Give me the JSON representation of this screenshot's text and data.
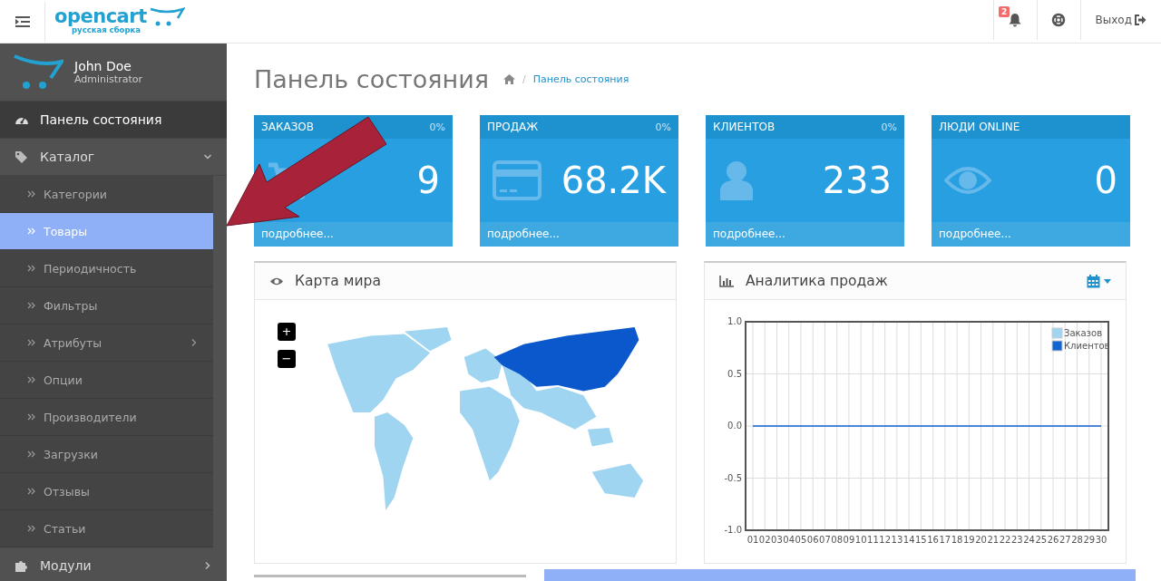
{
  "header": {
    "logo": {
      "name": "opencart",
      "subtitle": "русская сборка"
    },
    "notifications": {
      "count": "2"
    },
    "logout": "Выход"
  },
  "profile": {
    "name": "John Doe",
    "role": "Administrator"
  },
  "sidebar": {
    "items": [
      {
        "label": "Панель состояния",
        "kind": "dashboard",
        "selected": false
      },
      {
        "label": "Каталог",
        "kind": "catalog",
        "selected": false,
        "expanded": true,
        "children": [
          {
            "label": "Категории",
            "selected": false
          },
          {
            "label": "Товары",
            "selected": true
          },
          {
            "label": "Периодичность",
            "selected": false
          },
          {
            "label": "Фильтры",
            "selected": false
          },
          {
            "label": "Атрибуты",
            "selected": false,
            "expanded": false
          },
          {
            "label": "Опции",
            "selected": false
          },
          {
            "label": "Производители",
            "selected": false
          },
          {
            "label": "Загрузки",
            "selected": false
          },
          {
            "label": "Отзывы",
            "selected": false
          },
          {
            "label": "Статьи",
            "selected": false
          }
        ]
      },
      {
        "label": "Модули",
        "kind": "modules",
        "selected": false,
        "expanded": false
      }
    ]
  },
  "page": {
    "title": "Панель состояния",
    "breadcrumb": [
      {
        "separator": "/",
        "label": "Панель состояния"
      }
    ]
  },
  "stats": [
    {
      "kind": "orders",
      "title": "ЗАКАЗОВ",
      "percent": "0%",
      "value": "9",
      "footer": "подробнее..."
    },
    {
      "kind": "sales",
      "title": "ПРОДАЖ",
      "percent": "0%",
      "value": "68.2K",
      "footer": "подробнее..."
    },
    {
      "kind": "customers",
      "title": "КЛИЕНТОВ",
      "percent": "0%",
      "value": "233",
      "footer": "подробнее..."
    },
    {
      "kind": "online",
      "title": "ЛЮДИ ONLINE",
      "value": "0",
      "footer": "подробнее..."
    }
  ],
  "map_panel": {
    "title": "Карта мира",
    "zoom_in": "+",
    "zoom_out": "−"
  },
  "sales_panel": {
    "title": "Аналитика продаж",
    "chart_data": {
      "type": "line",
      "categories": [
        "01",
        "02",
        "03",
        "04",
        "05",
        "06",
        "07",
        "08",
        "09",
        "10",
        "11",
        "12",
        "13",
        "14",
        "15",
        "16",
        "17",
        "18",
        "19",
        "20",
        "21",
        "22",
        "23",
        "24",
        "25",
        "26",
        "27",
        "28",
        "29",
        "30"
      ],
      "series": [
        {
          "name": "Заказов",
          "color": "#9fd5f1",
          "values": [
            null,
            null,
            null,
            null,
            null,
            null,
            null,
            null,
            null,
            null,
            null,
            null,
            null,
            null,
            null,
            null,
            null,
            null,
            null,
            null,
            null,
            null,
            null,
            null,
            null,
            null,
            null,
            null,
            null,
            null
          ]
        },
        {
          "name": "Клиентов",
          "color": "#1065d2",
          "values": [
            0,
            0,
            0,
            0,
            0,
            0,
            0,
            0,
            0,
            0,
            0,
            0,
            0,
            0,
            0,
            0,
            0,
            0,
            0,
            0,
            0,
            0,
            0,
            0,
            0,
            0,
            0,
            0,
            0,
            0
          ]
        }
      ],
      "ylim": [
        -1,
        1
      ],
      "grid": true,
      "legend": true,
      "yticks": [
        {
          "value": 1,
          "label": "1.0"
        },
        {
          "value": 0.5,
          "label": "0.5"
        },
        {
          "value": 0,
          "label": "0.0"
        },
        {
          "value": -0.5,
          "label": "-0.5"
        },
        {
          "value": -1,
          "label": "-1.0"
        }
      ]
    }
  }
}
